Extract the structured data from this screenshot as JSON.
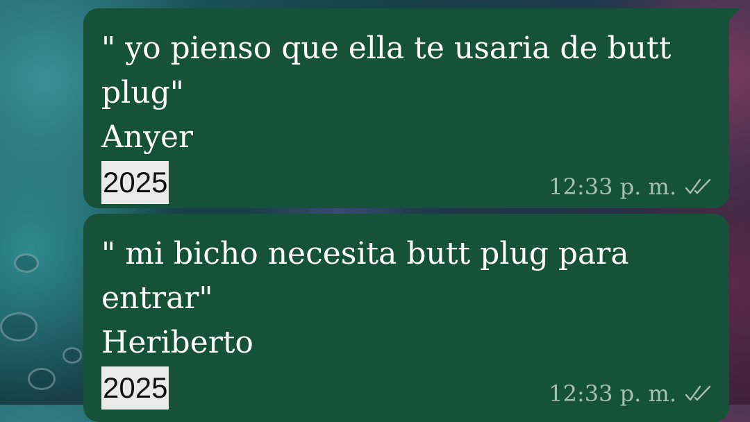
{
  "messages": [
    {
      "lines": [
        "\" yo pienso que ella te usaria de butt",
        "plug\"",
        "Anyer"
      ],
      "year": "2025",
      "time": "12:33 p. m.",
      "status_icon": "double-check-icon"
    },
    {
      "lines": [
        "\" mi bicho necesita butt plug para",
        "entrar\"",
        "Heriberto"
      ],
      "year": "2025",
      "time": "12:33 p. m.",
      "status_icon": "double-check-icon"
    }
  ],
  "colors": {
    "bubble": "#165139",
    "meta_text": "#a7c1b1",
    "highlight": "#eaeaea"
  }
}
